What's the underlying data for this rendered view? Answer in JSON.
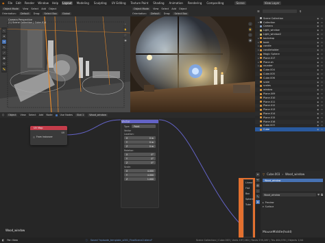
{
  "menubar": {
    "items": [
      "File",
      "Edit",
      "Render",
      "Window",
      "Help"
    ],
    "workspaces": [
      "Layout",
      "Modeling",
      "Sculpting",
      "UV Editing",
      "Texture Paint",
      "Shading",
      "Animation",
      "Rendering",
      "Compositing"
    ],
    "active_workspace": "Layout",
    "scene": "Scene",
    "view_layer": "View Layer"
  },
  "viewport_left": {
    "mode": "Object Mode",
    "menus": [
      "View",
      "Select",
      "Add",
      "Object"
    ],
    "orientation_label": "Orientation:",
    "orientation": "Default",
    "drag_label": "Drag:",
    "drag": "Select Box",
    "pivot": "Global",
    "overlay_line1": "Camera Perspective",
    "overlay_line2": "(1) Scene Collection | Cube.014"
  },
  "viewport_right": {
    "mode": "Object Mode",
    "menus": [
      "View",
      "Select",
      "Add",
      "Object"
    ],
    "orientation_label": "Orientation:",
    "orientation": "Default",
    "drag_label": "Drag:",
    "drag": "Select Box"
  },
  "node_editor": {
    "editor": "Object",
    "menus": [
      "View",
      "Select",
      "Add",
      "Node"
    ],
    "use_nodes": "Use Nodes",
    "slot": "Slot 1",
    "material": "Wood_window",
    "corner_label": "Wood_window",
    "uvmap_node": {
      "title": "UV Map",
      "output": "UV",
      "option": "From Instancer"
    },
    "vector_node": {
      "title": "Vector",
      "type_label": "Type:",
      "type": "Point",
      "vector_label": "Vector",
      "location_label": "Location:",
      "location": [
        {
          "axis": "X",
          "value": "0 m"
        },
        {
          "axis": "Y",
          "value": "0 m"
        },
        {
          "axis": "Z",
          "value": "0 m"
        }
      ],
      "rotation_label": "Rotation:",
      "rotation": [
        {
          "axis": "X",
          "value": "0°"
        },
        {
          "axis": "Y",
          "value": "0°"
        },
        {
          "axis": "Z",
          "value": "0°"
        }
      ],
      "scale_label": "Scale:",
      "scale": [
        {
          "axis": "X",
          "value": "4.000"
        },
        {
          "axis": "Y",
          "value": "4.000"
        },
        {
          "axis": "Z",
          "value": "1.000"
        }
      ]
    }
  },
  "popup_menu": {
    "items": [
      "Linear",
      "Flat",
      "Box",
      "Sphere",
      "Tube"
    ]
  },
  "outliner": {
    "items": [
      {
        "label": "Scene Collection",
        "color": "#b9b9b9",
        "expand": ""
      },
      {
        "label": "Collection",
        "color": "#b9b9b9",
        "expand": "▾"
      },
      {
        "label": "Camera",
        "color": "#8aa3c8",
        "expand": ""
      },
      {
        "label": "Light_window",
        "color": "#d9c36b",
        "expand": ""
      },
      {
        "label": "Light_window2",
        "color": "#d9c36b",
        "expand": ""
      },
      {
        "label": "backdrop",
        "color": "#e49a3a",
        "expand": "▸"
      },
      {
        "label": "book",
        "color": "#e49a3a",
        "expand": "▸"
      },
      {
        "label": "candle",
        "color": "#e49a3a",
        "expand": "▸"
      },
      {
        "label": "candleholder",
        "color": "#e49a3a",
        "expand": "▸"
      },
      {
        "label": "Magic Sphere",
        "color": "#e49a3a",
        "expand": "▸"
      },
      {
        "label": "Plane.017",
        "color": "#e49a3a",
        "expand": "▸"
      },
      {
        "label": "Plane.sh",
        "color": "#e49a3a",
        "expand": "▸"
      },
      {
        "label": "rounder",
        "color": "#e49a3a",
        "expand": "▸"
      },
      {
        "label": "Cube.004",
        "color": "#e49a3a",
        "expand": ""
      },
      {
        "label": "Cube.005",
        "color": "#e49a3a",
        "expand": ""
      },
      {
        "label": "Cube.006",
        "color": "#e49a3a",
        "expand": ""
      },
      {
        "label": "scale",
        "color": "#e49a3a",
        "expand": ""
      },
      {
        "label": "scales",
        "color": "#e49a3a",
        "expand": ""
      },
      {
        "label": "window",
        "color": "#e49a3a",
        "expand": ""
      },
      {
        "label": "Plane.009",
        "color": "#e49a3a",
        "expand": ""
      },
      {
        "label": "Plane.010",
        "color": "#e49a3a",
        "expand": ""
      },
      {
        "label": "Plane.011",
        "color": "#e49a3a",
        "expand": ""
      },
      {
        "label": "Plane.012",
        "color": "#e49a3a",
        "expand": ""
      },
      {
        "label": "Plane.013",
        "color": "#e49a3a",
        "expand": ""
      },
      {
        "label": "Plane.014",
        "color": "#e49a3a",
        "expand": ""
      },
      {
        "label": "Plane.015",
        "color": "#e49a3a",
        "expand": ""
      },
      {
        "label": "Plane.016",
        "color": "#e49a3a",
        "expand": ""
      },
      {
        "label": "Cube.003",
        "color": "#e49a3a",
        "expand": ""
      },
      {
        "label": "Cube",
        "color": "#e49a3a",
        "expand": "",
        "selected": true
      }
    ]
  },
  "properties": {
    "object": "Cube.003",
    "material": "Wood_window",
    "sections": [
      "Preview",
      "Surface"
    ],
    "shortcut_hint": "MouseMiddle(hold)"
  },
  "statusbar": {
    "left": "Pan View",
    "message": "Saved \"episode_template_v001_FinalScene2.blend\"",
    "right": "Scene Collection | Cube.003 | Verts 197,261 | Faces 235,287 | Tris 464,578 | Objects 1/44"
  },
  "colors": {
    "accent": "#4772b3",
    "selected_row": "#2a5a9e",
    "uv_node_header": "#c43c4a",
    "vector_node_header": "#6363c7",
    "orange_strip": "#e3702f"
  }
}
